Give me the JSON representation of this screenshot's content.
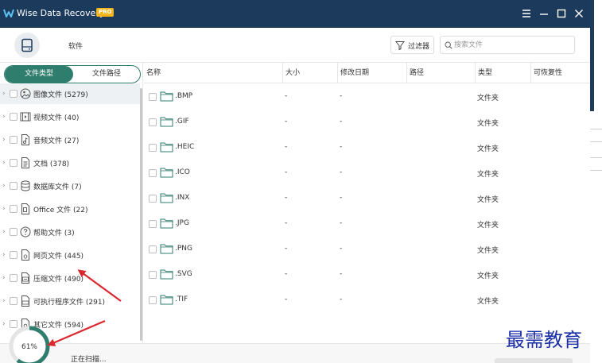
{
  "app": {
    "title": "Wise Data Recovery",
    "badge": "PRO",
    "accent": "#2f7d6d",
    "titlebar_color": "#1b3a5c"
  },
  "window_controls": [
    "menu-icon",
    "minimize-icon",
    "maximize-icon",
    "close-icon"
  ],
  "toolbar": {
    "device_label": "软件",
    "filter_label": "过滤器",
    "search_placeholder": "搜索文件"
  },
  "tabs": [
    {
      "label": "文件类型",
      "active": true
    },
    {
      "label": "文件路径",
      "active": false
    }
  ],
  "categories": [
    {
      "label": "图像文件 (5279)",
      "icon": "image-file-icon",
      "selected": true
    },
    {
      "label": "视频文件 (40)",
      "icon": "video-file-icon"
    },
    {
      "label": "音频文件 (27)",
      "icon": "audio-file-icon"
    },
    {
      "label": "文档 (378)",
      "icon": "document-icon"
    },
    {
      "label": "数据库文件 (7)",
      "icon": "database-icon"
    },
    {
      "label": "Office 文件 (22)",
      "icon": "office-file-icon"
    },
    {
      "label": "帮助文件 (3)",
      "icon": "help-file-icon"
    },
    {
      "label": "网页文件 (445)",
      "icon": "web-file-icon"
    },
    {
      "label": "压缩文件 (490)",
      "icon": "zip-file-icon"
    },
    {
      "label": "可执行程序文件 (291)",
      "icon": "exe-file-icon"
    },
    {
      "label": "其它文件 (594)",
      "icon": "other-file-icon"
    }
  ],
  "table": {
    "columns": [
      "名称",
      "大小",
      "修改日期",
      "路径",
      "类型",
      "可恢复性"
    ],
    "rows": [
      {
        "name": ".BMP",
        "size": "-",
        "date": "-",
        "type": "文件夹"
      },
      {
        "name": ".GIF",
        "size": "-",
        "date": "-",
        "type": "文件夹"
      },
      {
        "name": ".HEIC",
        "size": "-",
        "date": "-",
        "type": "文件夹"
      },
      {
        "name": ".ICO",
        "size": "-",
        "date": "-",
        "type": "文件夹"
      },
      {
        "name": ".INX",
        "size": "-",
        "date": "-",
        "type": "文件夹"
      },
      {
        "name": ".JPG",
        "size": "-",
        "date": "-",
        "type": "文件夹"
      },
      {
        "name": ".PNG",
        "size": "-",
        "date": "-",
        "type": "文件夹"
      },
      {
        "name": ".SVG",
        "size": "-",
        "date": "-",
        "type": "文件夹"
      },
      {
        "name": ".TIF",
        "size": "-",
        "date": "-",
        "type": "文件夹"
      }
    ]
  },
  "status": {
    "progress_text": "61%",
    "progress_value": 0.61,
    "scan_text": "正在扫描..."
  },
  "watermark": "最需教育",
  "annotation_color": "#d9282f"
}
